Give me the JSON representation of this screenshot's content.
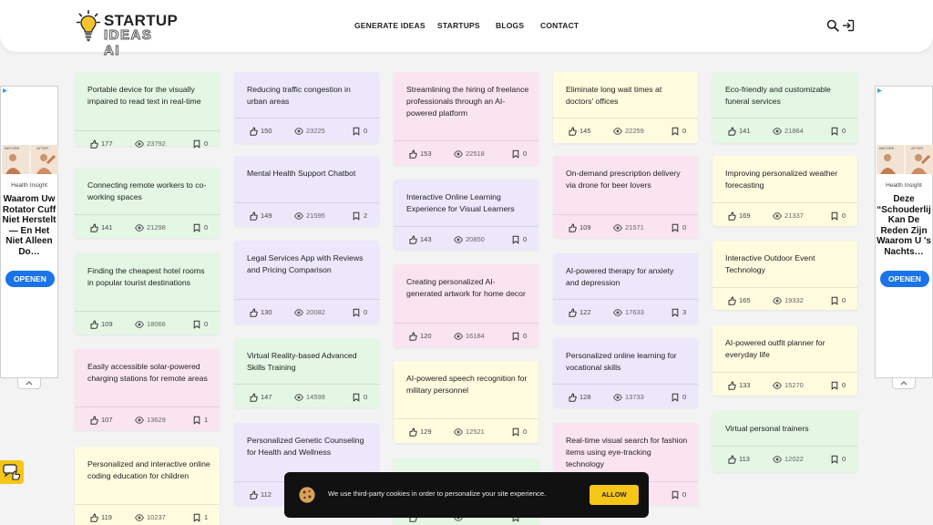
{
  "brand": {
    "line1": "STARTUP",
    "line2": "IDEAS AI"
  },
  "nav": {
    "generate": "GENERATE IDEAS",
    "startups": "STARTUPS",
    "blogs": "BLOGS",
    "contact": "CONTACT"
  },
  "colors": {
    "green": "#e3f7e4",
    "purple": "#ece7fb",
    "pink": "#fae4ef",
    "yellow": "#fefbdf",
    "accent": "#f5c518",
    "ad_button": "#1a73e8"
  },
  "cards": [
    {
      "title": "Portable device for the visually impaired to read text in real-time",
      "likes": "177",
      "views": "23792",
      "saves": "0"
    },
    {
      "title": "Connecting remote workers to co-working spaces",
      "likes": "141",
      "views": "21298",
      "saves": "0"
    },
    {
      "title": "Finding the cheapest hotel rooms in popular tourist destinations",
      "likes": "109",
      "views": "18066",
      "saves": "0"
    },
    {
      "title": "Easily accessible solar-powered charging stations for remote areas",
      "likes": "107",
      "views": "13629",
      "saves": "1"
    },
    {
      "title": "Personalized and interactive online coding education for children",
      "likes": "119",
      "views": "10237",
      "saves": "1"
    },
    {
      "title": "Reducing traffic congestion in urban areas",
      "likes": "150",
      "views": "23225",
      "saves": "0"
    },
    {
      "title": "Mental Health Support Chatbot",
      "likes": "149",
      "views": "21595",
      "saves": "2"
    },
    {
      "title": "Legal Services App with Reviews and Pricing Comparison",
      "likes": "130",
      "views": "20082",
      "saves": "0"
    },
    {
      "title": "Virtual Reality-based Advanced Skills Training",
      "likes": "147",
      "views": "14599",
      "saves": "0"
    },
    {
      "title": "Personalized Genetic Counseling for Health and Wellness",
      "likes": "112",
      "views": "",
      "saves": ""
    },
    {
      "title": "Streamlining the hiring of freelance professionals through an AI-powered platform",
      "likes": "153",
      "views": "22518",
      "saves": "0"
    },
    {
      "title": "Interactive Online Learning Experience for Visual Learners",
      "likes": "143",
      "views": "20850",
      "saves": "0"
    },
    {
      "title": "Creating personalized AI-generated artwork for home decor",
      "likes": "120",
      "views": "16184",
      "saves": "0"
    },
    {
      "title": "AI-powered speech recognition for military personnel",
      "likes": "129",
      "views": "12521",
      "saves": "0"
    },
    {
      "title": "",
      "likes": "",
      "views": "",
      "saves": ""
    },
    {
      "title": "Eliminate long wait times at doctors' offices",
      "likes": "145",
      "views": "22259",
      "saves": "0"
    },
    {
      "title": "On-demand prescription delivery via drone for beer lovers",
      "likes": "109",
      "views": "21571",
      "saves": "0"
    },
    {
      "title": "AI-powered therapy for anxiety and depression",
      "likes": "122",
      "views": "17633",
      "saves": "3"
    },
    {
      "title": "Personalized online learning for vocational skills",
      "likes": "128",
      "views": "13733",
      "saves": "0"
    },
    {
      "title": "Real-time visual search for fashion items using eye-tracking technology",
      "likes": "",
      "views": "",
      "saves": "0"
    },
    {
      "title": "Eco-friendly and customizable funeral services",
      "likes": "141",
      "views": "21864",
      "saves": "0"
    },
    {
      "title": "Improving personalized weather forecasting",
      "likes": "169",
      "views": "21337",
      "saves": "0"
    },
    {
      "title": "Interactive Outdoor Event Technology",
      "likes": "165",
      "views": "19332",
      "saves": "0"
    },
    {
      "title": "AI-powered outfit planner for everyday life",
      "likes": "133",
      "views": "15270",
      "saves": "0"
    },
    {
      "title": "Virtual personal trainers",
      "likes": "113",
      "views": "12022",
      "saves": "0"
    }
  ],
  "ads": [
    {
      "source": "Health Insight",
      "headline": "Waarom Uw Rotator Cuff Niet Herstelt — En Het Niet Alleen Do…",
      "button": "OPENEN",
      "img_left": "BEFORE",
      "img_right": "AFTER"
    },
    {
      "source": "Health Insight",
      "headline": "Deze “Schouderlij Kan De Reden Zijn Waarom U 's Nachts…",
      "button": "OPENEN",
      "img_left": "BEFORE",
      "img_right": "AFTER"
    }
  ],
  "cookie": {
    "message": "We use third-party cookies in order to personalize your site experience.",
    "button": "ALLOW"
  }
}
